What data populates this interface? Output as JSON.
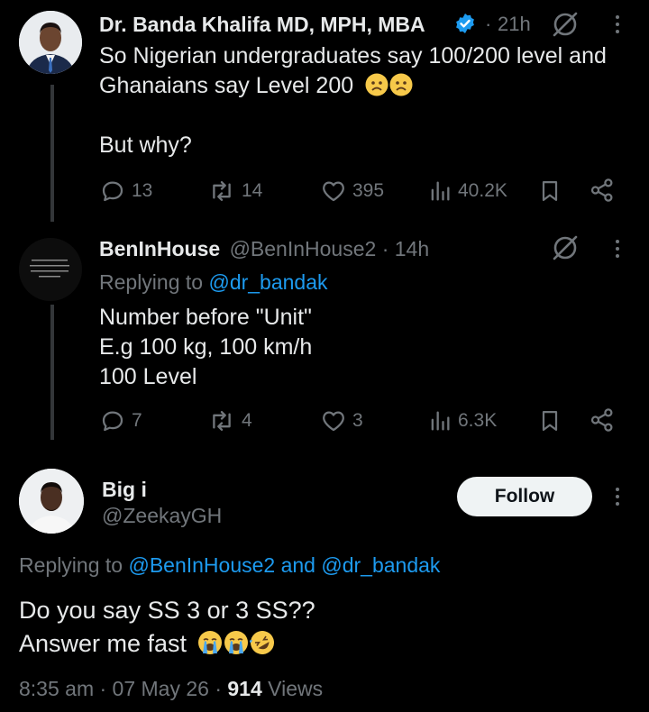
{
  "tweet1": {
    "display_name": "Dr. Banda Khalifa MD, MPH, MBA",
    "separator": "·",
    "time": "21h",
    "text_line1": "So Nigerian undergraduates say 100/200 level and",
    "text_line2": "Ghanaians say Level 200",
    "text_line3": "But why?",
    "emojis": [
      "frowning-face",
      "frowning-face"
    ],
    "replies": "13",
    "reposts": "14",
    "likes": "395",
    "views": "40.2K"
  },
  "tweet2": {
    "display_name": "BenInHouse",
    "handle": "@BenInHouse2 · 14h",
    "replying_prefix": "Replying to ",
    "replying_handle": "@dr_bandak",
    "text_line1": "Number before \"Unit\"",
    "text_line2": "E.g 100 kg, 100 km/h",
    "text_line3": "100 Level",
    "replies": "7",
    "reposts": "4",
    "likes": "3",
    "views": "6.3K"
  },
  "tweet3": {
    "display_name": "Big i",
    "handle": "@ZeekayGH",
    "follow_label": "Follow",
    "replying_prefix": "Replying to ",
    "replying_handles": "@BenInHouse2 and @dr_bandak",
    "text_line1": "Do you say SS 3 or 3 SS??",
    "text_line2": "Answer me fast",
    "emojis": [
      "loudly-crying-face",
      "loudly-crying-face",
      "rolling-on-floor-laughing-face"
    ],
    "timestamp": "8:35 am · 07 May 26 · ",
    "views_count": "914",
    "views_label": " Views"
  },
  "colors": {
    "background": "#000000",
    "text": "#e7e9ea",
    "muted": "#71767b",
    "link": "#1d9bf0",
    "verified": "#1d9bf0",
    "thread_line": "#333639"
  }
}
